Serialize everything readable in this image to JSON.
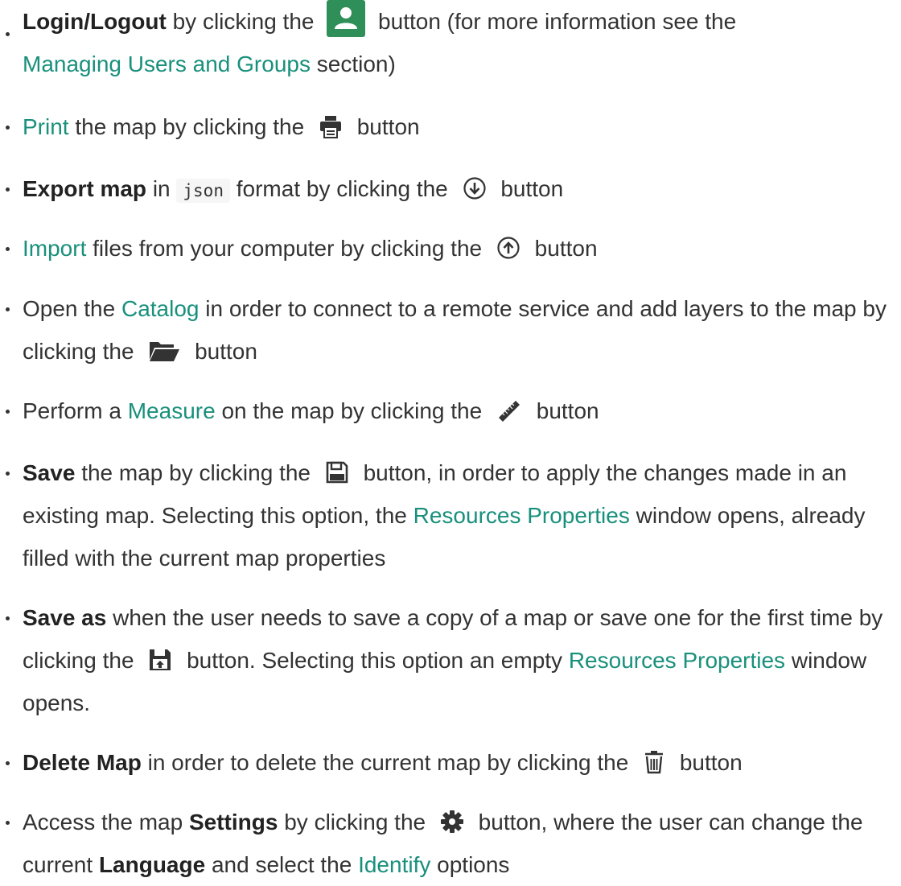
{
  "colors": {
    "link": "#19907c",
    "user_button": "#2f8f59",
    "icon": "#333333"
  },
  "items": {
    "login": {
      "bold": "Login/Logout",
      "pre": "by clicking the",
      "icon": "user-icon",
      "post": "button (for more information see the",
      "link": "Managing Users and Groups",
      "post2": "section)"
    },
    "print": {
      "link": "Print",
      "pre": "the map by clicking the",
      "icon": "print-icon",
      "post": "button"
    },
    "export": {
      "bold": "Export map",
      "pre": "in",
      "code": "json",
      "pre2": "format by clicking the",
      "icon": "download-circle-icon",
      "post": "button"
    },
    "import": {
      "link": "Import",
      "pre": "files from your computer by clicking the",
      "icon": "upload-circle-icon",
      "post": "button"
    },
    "catalog": {
      "pre": "Open the",
      "link": "Catalog",
      "post": "in order to connect to a remote service and add layers to the map by clicking the",
      "icon": "folder-open-icon",
      "post2": "button"
    },
    "measure": {
      "pre": "Perform a",
      "link": "Measure",
      "post": "on the map by clicking the",
      "icon": "ruler-icon",
      "post2": "button"
    },
    "save": {
      "bold": "Save",
      "pre": "the map by clicking the",
      "icon": "floppy-disk-icon",
      "post": "button, in order to apply the changes made in an existing map. Selecting this option, the",
      "link": "Resources Properties",
      "post2": "window opens, already filled with the current map properties"
    },
    "save_as": {
      "bold": "Save as",
      "pre": "when the user needs to save a copy of a map or save one for the first time by clicking the",
      "icon": "save-as-icon",
      "post": "button. Selecting this option an empty",
      "link": "Resources Properties",
      "post2": "window opens."
    },
    "delete": {
      "bold": "Delete Map",
      "pre": "in order to delete the current map by clicking the",
      "icon": "trash-icon",
      "post": "button"
    },
    "settings": {
      "pre": "Access the map",
      "bold": "Settings",
      "pre2": "by clicking the",
      "icon": "gear-icon",
      "post": "button, where the user can change the current",
      "bold2": "Language",
      "post2": "and select the",
      "link": "Identify",
      "post3": "options"
    }
  }
}
